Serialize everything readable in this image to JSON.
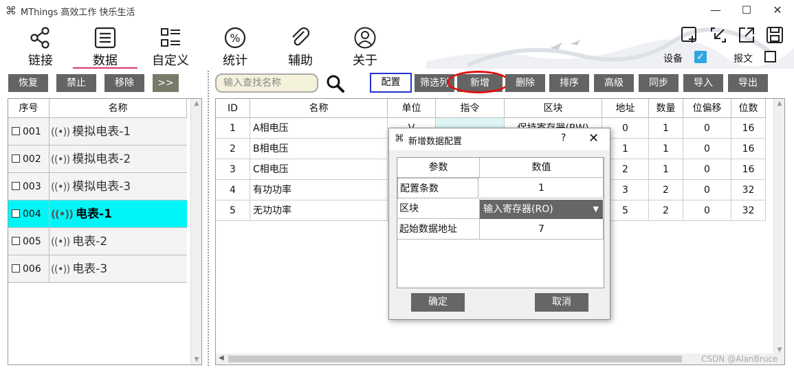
{
  "window": {
    "app_icon": "⌘",
    "title": "MThings 高效工作 快乐生活",
    "minimize": "—",
    "maximize": "☐",
    "close": "✕"
  },
  "nav": {
    "items": [
      {
        "label": "链接",
        "icon": "share-icon"
      },
      {
        "label": "数据",
        "icon": "list-icon"
      },
      {
        "label": "自定义",
        "icon": "grid-list-icon"
      },
      {
        "label": "统计",
        "icon": "percent-icon"
      },
      {
        "label": "辅助",
        "icon": "paperclip-icon"
      },
      {
        "label": "关于",
        "icon": "user-icon"
      }
    ],
    "active": "数据"
  },
  "top_right": {
    "device_label": "设备",
    "device_checked": true,
    "report_label": "报文",
    "report_checked": false
  },
  "left_toolbar": {
    "restore": "恢复",
    "disable": "禁止",
    "remove": "移除",
    "expand": ">>"
  },
  "left_list": {
    "headers": [
      "序号",
      "名称"
    ],
    "rows": [
      {
        "id": "001",
        "name": "模拟电表-1",
        "selected": false
      },
      {
        "id": "002",
        "name": "模拟电表-2",
        "selected": false
      },
      {
        "id": "003",
        "name": "模拟电表-3",
        "selected": false
      },
      {
        "id": "004",
        "name": "电表-1",
        "selected": true
      },
      {
        "id": "005",
        "name": "电表-2",
        "selected": false
      },
      {
        "id": "006",
        "name": "电表-3",
        "selected": false
      }
    ]
  },
  "right_toolbar": {
    "search_placeholder": "输入查找名称",
    "config": "配置",
    "filter": "筛选列",
    "add": "新增",
    "delete": "删除",
    "sort": "排序",
    "advanced": "高级",
    "sync": "同步",
    "import": "导入",
    "export": "导出"
  },
  "table": {
    "headers": [
      "ID",
      "名称",
      "单位",
      "指令",
      "区块",
      "地址",
      "数量",
      "位偏移",
      "位数"
    ],
    "rows": [
      {
        "id": "1",
        "name": "A相电压",
        "unit": "V",
        "cmd": "",
        "block": "保持寄存器(RW)",
        "addr": "0",
        "count": "1",
        "bitoff": "0",
        "bits": "16"
      },
      {
        "id": "2",
        "name": "B相电压",
        "unit": "",
        "cmd": "",
        "block": "",
        "addr": "1",
        "count": "1",
        "bitoff": "0",
        "bits": "16"
      },
      {
        "id": "3",
        "name": "C相电压",
        "unit": "",
        "cmd": "",
        "block": "",
        "addr": "2",
        "count": "1",
        "bitoff": "0",
        "bits": "16"
      },
      {
        "id": "4",
        "name": "有功功率",
        "unit": "",
        "cmd": "",
        "block": "",
        "addr": "3",
        "count": "2",
        "bitoff": "0",
        "bits": "32"
      },
      {
        "id": "5",
        "name": "无功功率",
        "unit": "",
        "cmd": "",
        "block": "",
        "addr": "5",
        "count": "2",
        "bitoff": "0",
        "bits": "32"
      }
    ]
  },
  "dialog": {
    "icon": "⌘",
    "title": "新增数据配置",
    "help": "?",
    "close": "✕",
    "headers": [
      "参数",
      "数值"
    ],
    "rows": [
      {
        "param": "配置条数",
        "value": "1"
      },
      {
        "param": "区块",
        "value": "输入寄存器(RO)"
      },
      {
        "param": "起始数据地址",
        "value": "7"
      }
    ],
    "ok": "确定",
    "cancel": "取消"
  },
  "watermark": "CSDN @AlanBruce",
  "colors": {
    "selected_row": "#00f6f6",
    "gray_button": "#646464",
    "accent_underline": "#d9366a",
    "highlight_circle": "#e01010",
    "config_border": "#2233cc",
    "checkbox_blue": "#2ea7e0",
    "search_bg": "#f5f2dc"
  }
}
